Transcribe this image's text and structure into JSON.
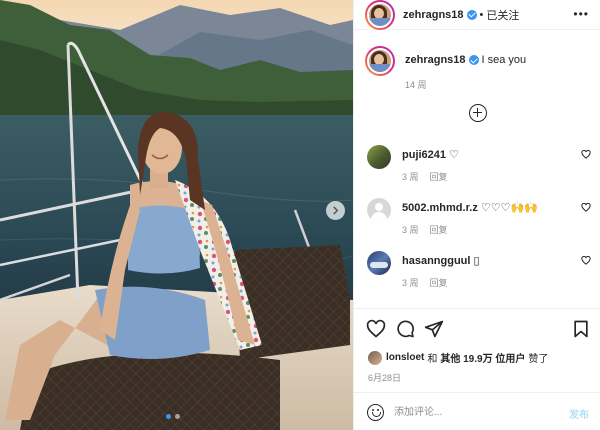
{
  "header": {
    "username": "zehragns18",
    "separator": "•",
    "follow_state": "已关注",
    "more_icon": "more-horizontal-icon"
  },
  "caption": {
    "username": "zehragns18",
    "text": "I sea you",
    "time": "14 周"
  },
  "comments": [
    {
      "username": "puji6241",
      "text": "♡",
      "time": "3 周",
      "reply": "回复"
    },
    {
      "username": "5002.mhmd.r.z",
      "text": "♡♡♡🙌🙌",
      "time": "3 周",
      "reply": "回复"
    },
    {
      "username": "hasanngguul",
      "text": "▯",
      "time": "3 周",
      "reply": "回复"
    }
  ],
  "likes": {
    "user": "lonsloet",
    "connector": "和",
    "others": "其他 19.9万 位用户",
    "suffix": "赞了"
  },
  "post_date": "6月28日",
  "comment_box": {
    "placeholder": "添加评论...",
    "post_label": "发布"
  },
  "carousel": {
    "slides": 2,
    "active_index": 0
  },
  "colors": {
    "accent": "#3897f0",
    "muted": "#8e8e8e",
    "text": "#262626",
    "post_disabled": "#b2dffc"
  }
}
